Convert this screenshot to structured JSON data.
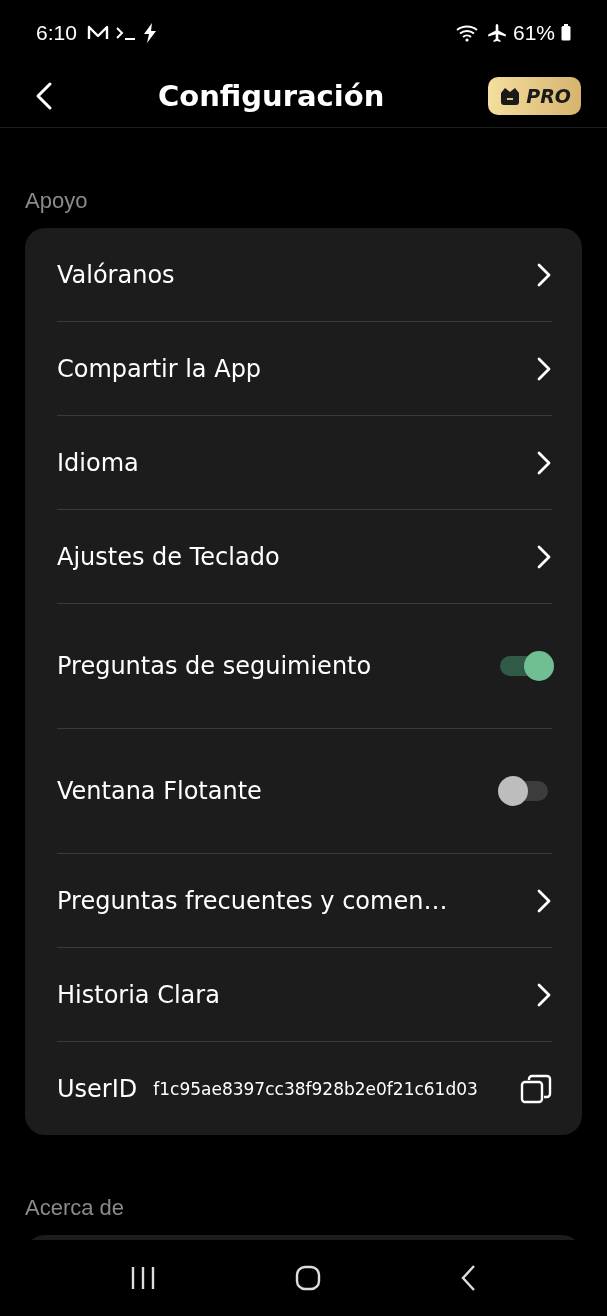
{
  "status_bar": {
    "time": "6:10",
    "battery": "61%"
  },
  "header": {
    "title": "Configuración",
    "pro_badge": "PRO"
  },
  "sections": [
    {
      "title": "Apoyo",
      "items": [
        {
          "kind": "link",
          "label": "Valóranos"
        },
        {
          "kind": "link",
          "label": "Compartir la App"
        },
        {
          "kind": "link",
          "label": "Idioma"
        },
        {
          "kind": "link",
          "label": "Ajustes de Teclado"
        },
        {
          "kind": "toggle",
          "label": "Preguntas de seguimiento",
          "on": true
        },
        {
          "kind": "toggle",
          "label": "Ventana Flotante",
          "on": false
        },
        {
          "kind": "link",
          "label": "Preguntas frecuentes y comen…"
        },
        {
          "kind": "link",
          "label": "Historia Clara"
        },
        {
          "kind": "userid",
          "label": "UserID",
          "value": "f1c95ae8397cc38f928b2e0f21c61d03"
        }
      ]
    },
    {
      "title": "Acerca de"
    }
  ]
}
